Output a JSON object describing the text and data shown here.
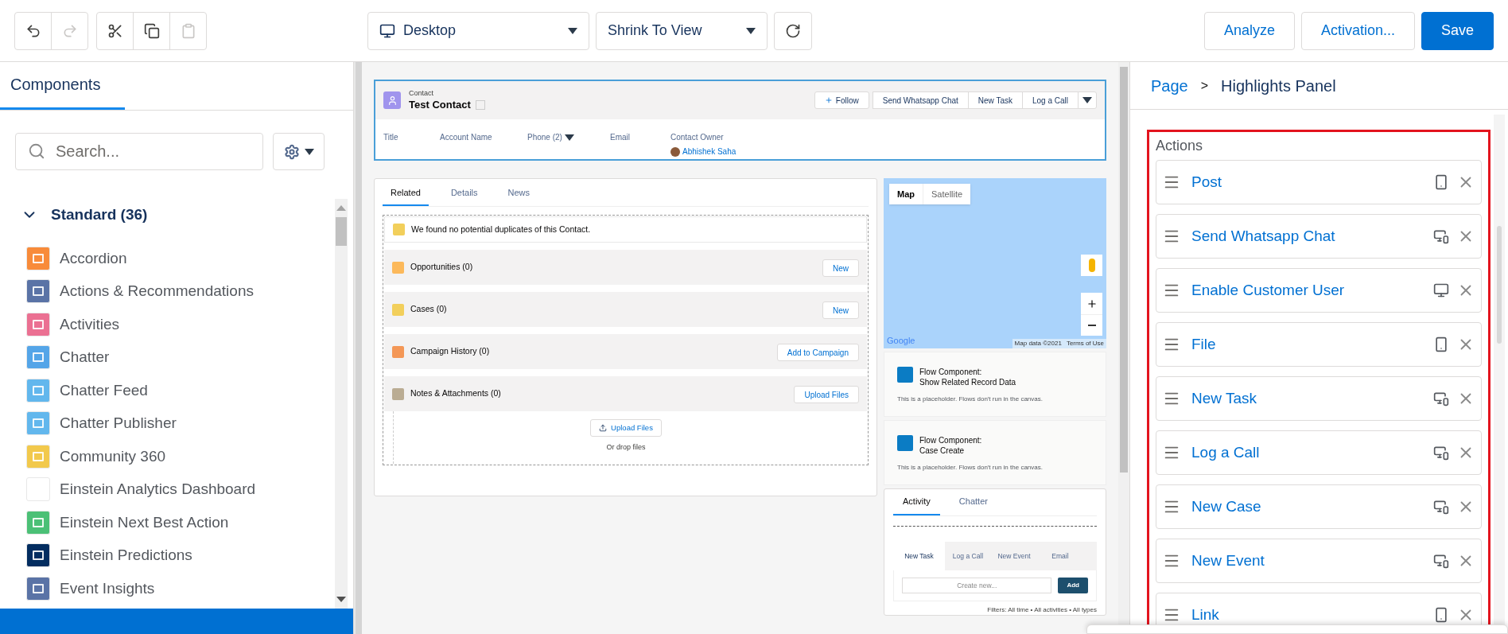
{
  "toolbar": {
    "tools": [
      {
        "kind": "undo",
        "disabled": false
      },
      {
        "kind": "redo",
        "disabled": true
      },
      {
        "kind": "cut",
        "disabled": false
      },
      {
        "kind": "copy",
        "disabled": false
      },
      {
        "kind": "paste",
        "disabled": true
      }
    ],
    "view_select": "Desktop",
    "zoom_select": "Shrink To View",
    "buttons": [
      {
        "label": "Analyze",
        "primary": false
      },
      {
        "label": "Activation...",
        "primary": false
      },
      {
        "label": "Save",
        "primary": true
      }
    ]
  },
  "sidebar": {
    "tab": "Components",
    "search": {
      "placeholder": "Search..."
    },
    "section": {
      "title": "Standard (36)",
      "expanded": true
    },
    "items": [
      {
        "label": "Accordion",
        "color": "#f88b3a"
      },
      {
        "label": "Actions & Recommendations",
        "color": "#5a73a6"
      },
      {
        "label": "Activities",
        "color": "#eb7092"
      },
      {
        "label": "Chatter",
        "color": "#54a5e8"
      },
      {
        "label": "Chatter Feed",
        "color": "#62b7ed"
      },
      {
        "label": "Chatter Publisher",
        "color": "#62b7ed"
      },
      {
        "label": "Community 360",
        "color": "#f2c94c"
      },
      {
        "label": "Einstein Analytics Dashboard",
        "color": "#ffffff"
      },
      {
        "label": "Einstein Next Best Action",
        "color": "#4bc076"
      },
      {
        "label": "Einstein Predictions",
        "color": "#032d60"
      },
      {
        "label": "Event Insights",
        "color": "#5a73a6"
      }
    ]
  },
  "canvas": {
    "highlights": {
      "object_type": "Contact",
      "name": "Test Contact",
      "actions": [
        "Follow",
        "Send Whatsapp Chat",
        "New Task",
        "Log a Call"
      ],
      "fields": [
        {
          "label": "Title"
        },
        {
          "label": "Account Name"
        },
        {
          "label": "Phone (2)"
        },
        {
          "label": "Email"
        },
        {
          "label": "Contact Owner",
          "value": "Abhishek Saha"
        }
      ]
    },
    "tabs": [
      {
        "label": "Related",
        "selected": true
      },
      {
        "label": "Details",
        "selected": false
      },
      {
        "label": "News",
        "selected": false
      }
    ],
    "duplicates": "We found no potential duplicates of this Contact.",
    "related_lists": [
      {
        "title": "Opportunities (0)",
        "button": "New",
        "color": "#fcb95b"
      },
      {
        "title": "Cases (0)",
        "button": "New",
        "color": "#f2cf5b"
      },
      {
        "title": "Campaign History (0)",
        "button": "Add to Campaign",
        "color": "#f49756"
      },
      {
        "title": "Notes & Attachments (0)",
        "button": "Upload Files",
        "color": "#baac93"
      }
    ],
    "upload": {
      "button": "Upload Files",
      "hint": "Or drop files"
    },
    "map": {
      "toggle": [
        {
          "label": "Map",
          "selected": true
        },
        {
          "label": "Satellite",
          "selected": false
        }
      ],
      "logo": "Google",
      "attribution": "Map data ©2021",
      "terms": "Terms of Use"
    },
    "flows": [
      {
        "title": "Flow Component:",
        "subtitle": "Show Related Record Data",
        "note": "This is a placeholder. Flows don't run in the canvas."
      },
      {
        "title": "Flow Component:",
        "subtitle": "Case Create",
        "note": "This is a placeholder. Flows don't run in the canvas."
      }
    ],
    "activity": {
      "tabs": [
        {
          "label": "Activity",
          "selected": true
        },
        {
          "label": "Chatter",
          "selected": false
        }
      ],
      "subtabs": [
        {
          "label": "New Task",
          "selected": true
        },
        {
          "label": "Log a Call",
          "selected": false
        },
        {
          "label": "New Event",
          "selected": false
        },
        {
          "label": "Email",
          "selected": false
        }
      ],
      "input": {
        "placeholder": "Create new..."
      },
      "button": "Add",
      "filters": "Filters: All time • All activities • All types"
    }
  },
  "properties": {
    "breadcrumb": [
      {
        "label": "Page",
        "link": true
      },
      {
        "label": "Highlights Panel",
        "link": false
      }
    ],
    "separator": ">",
    "title": "Actions",
    "actions": [
      {
        "label": "Post",
        "kind": "phone"
      },
      {
        "label": "Send Whatsapp Chat",
        "kind": "both"
      },
      {
        "label": "Enable Customer User",
        "kind": "desktop"
      },
      {
        "label": "File",
        "kind": "phone"
      },
      {
        "label": "New Task",
        "kind": "both"
      },
      {
        "label": "Log a Call",
        "kind": "both"
      },
      {
        "label": "New Case",
        "kind": "both"
      },
      {
        "label": "New Event",
        "kind": "both"
      },
      {
        "label": "Link",
        "kind": "phone"
      }
    ]
  }
}
